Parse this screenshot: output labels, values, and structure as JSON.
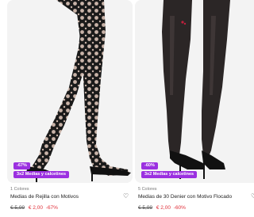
{
  "products": [
    {
      "discount_badge": "-67%",
      "promo_badge": "3x2 Medias y calcetines",
      "colors": "1 Colores",
      "name": "Medias de Rejilla con Motivos",
      "old_price": "€ 5,99",
      "new_price": "€ 2,00",
      "discount_text": "-67%",
      "heart_icon": "heart-outline-icon"
    },
    {
      "discount_badge": "-60%",
      "promo_badge": "3x2 Medias y calcetines",
      "colors": "5 Colores",
      "name": "Medias de 30 Denier con Motivo Flocado",
      "old_price": "€ 5,99",
      "new_price": "€ 2,00",
      "discount_text": "-60%",
      "heart_icon": "heart-outline-icon"
    }
  ],
  "colors": {
    "badge": "#9b30e0",
    "sale_price": "#e0303a"
  }
}
